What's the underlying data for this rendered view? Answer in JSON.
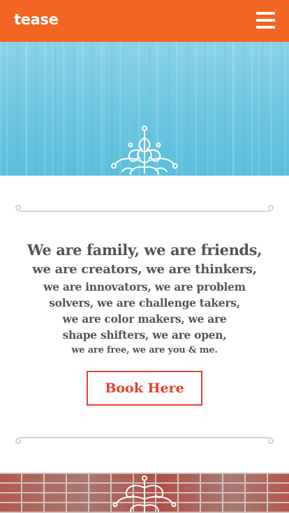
{
  "header": {
    "logo_text": "tease",
    "menu_icon": "hamburger-menu-icon",
    "background_color": "#f26522"
  },
  "hero": {
    "background_color": "#6dc6df",
    "ornament_icon": "snowflake-ornament-icon"
  },
  "intro": {
    "line1": "We are family, we are friends,",
    "line2": "we are creators, we are thinkers,",
    "line3": "we are innovators, we are problem",
    "line4": "solvers, we are challenge takers,",
    "line5": "we are color makers, we are",
    "line6": "shape shifters, we are open,",
    "line7": "we are free, we are you & me.",
    "text_color": "#555555"
  },
  "cta": {
    "book_label": "Book Here",
    "accent_color": "#e0442b"
  },
  "footer": {
    "ornament_icon": "snowflake-ornament-icon"
  }
}
